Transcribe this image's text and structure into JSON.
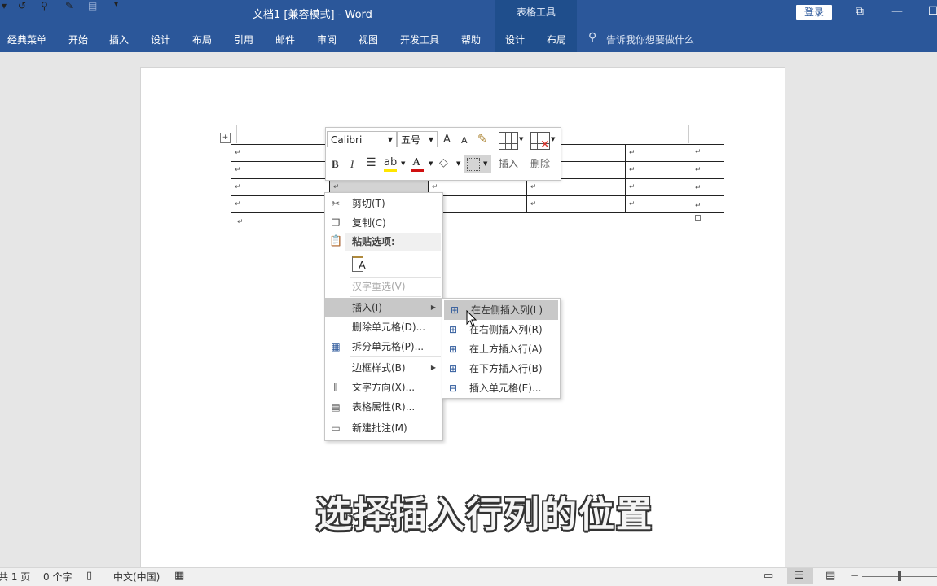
{
  "titlebar": {
    "quick_access": [
      "▾",
      "↺",
      "⚲",
      "✎",
      "▤",
      "▾"
    ],
    "document_title": "文档1 [兼容模式]  -  Word",
    "context_title": "表格工具",
    "login_label": "登录",
    "window_controls": [
      "⧉",
      "—",
      "☐"
    ]
  },
  "ribbon": {
    "tabs": [
      "经典菜单",
      "开始",
      "插入",
      "设计",
      "布局",
      "引用",
      "邮件",
      "审阅",
      "视图",
      "开发工具",
      "帮助",
      "设计",
      "布局"
    ],
    "tell_me": "告诉我你想要做什么"
  },
  "document": {
    "cell_mark": "↵",
    "para_mark": "↵"
  },
  "mini_toolbar": {
    "font_name": "Calibri",
    "font_size": "五号",
    "grow_font": "A",
    "shrink_font": "A",
    "bold": "B",
    "italic": "I",
    "insert_label": "插入",
    "delete_label": "删除"
  },
  "context_menu": {
    "items": [
      {
        "icon": "scissors-icon",
        "label": "剪切(T)"
      },
      {
        "icon": "copy-icon",
        "label": "复制(C)"
      },
      {
        "icon": "paste-icon",
        "label": "粘贴选项:"
      },
      {
        "icon": "reconvert-icon",
        "label": "汉字重选(V)"
      },
      {
        "icon": "insert-icon",
        "label": "插入(I)"
      },
      {
        "icon": "delete-cells-icon",
        "label": "删除单元格(D)..."
      },
      {
        "icon": "split-cells-icon",
        "label": "拆分单元格(P)..."
      },
      {
        "icon": "border-style-icon",
        "label": "边框样式(B)"
      },
      {
        "icon": "text-direction-icon",
        "label": "文字方向(X)..."
      },
      {
        "icon": "table-properties-icon",
        "label": "表格属性(R)..."
      },
      {
        "icon": "new-comment-icon",
        "label": "新建批注(M)"
      }
    ]
  },
  "submenu": {
    "items": [
      {
        "icon": "insert-col-left-icon",
        "label": "在左侧插入列(L)"
      },
      {
        "icon": "insert-col-right-icon",
        "label": "在右侧插入列(R)"
      },
      {
        "icon": "insert-row-above-icon",
        "label": "在上方插入行(A)"
      },
      {
        "icon": "insert-row-below-icon",
        "label": "在下方插入行(B)"
      },
      {
        "icon": "insert-cells-icon",
        "label": "插入单元格(E)..."
      }
    ]
  },
  "caption": "选择插入行列的位置",
  "statusbar": {
    "page": "共 1 页",
    "words": "0 个字",
    "language": "中文(中国)"
  }
}
